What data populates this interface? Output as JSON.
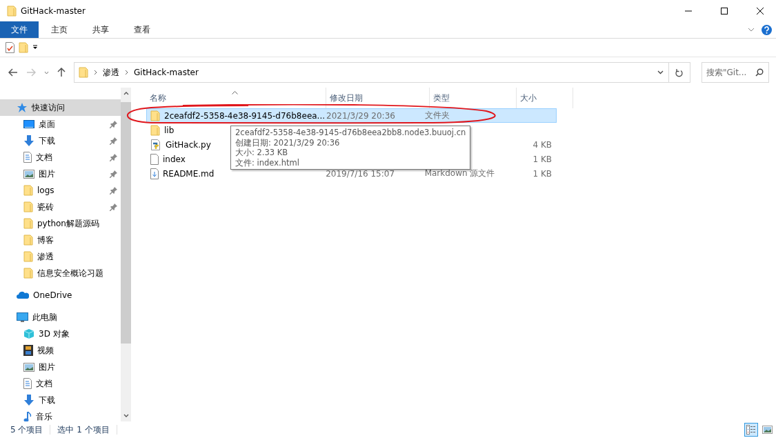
{
  "window": {
    "title": "GitHack-master"
  },
  "ribbon": {
    "tabs": [
      {
        "label": "文件",
        "selected": true
      },
      {
        "label": "主页",
        "selected": false
      },
      {
        "label": "共享",
        "selected": false
      },
      {
        "label": "查看",
        "selected": false
      }
    ]
  },
  "address": {
    "path": [
      "渗透",
      "GitHack-master"
    ],
    "search_placeholder": "搜索\"Git..."
  },
  "sidebar": {
    "items": [
      {
        "label": "快速访问",
        "kind": "star",
        "selected": true,
        "children": [
          {
            "label": "桌面",
            "kind": "desktop",
            "pinned": true,
            "selected": false
          },
          {
            "label": "下载",
            "kind": "download",
            "pinned": true,
            "selected": false
          },
          {
            "label": "文档",
            "kind": "document",
            "pinned": true,
            "selected": false
          },
          {
            "label": "图片",
            "kind": "pictures",
            "pinned": true,
            "selected": false
          },
          {
            "label": "logs",
            "kind": "folder",
            "pinned": true,
            "selected": false
          },
          {
            "label": "瓷砖",
            "kind": "folder",
            "pinned": true,
            "selected": false
          },
          {
            "label": "python解题源码",
            "kind": "folder",
            "pinned": false,
            "selected": false
          },
          {
            "label": "博客",
            "kind": "folder",
            "pinned": false,
            "selected": false
          },
          {
            "label": "渗透",
            "kind": "folder",
            "pinned": false,
            "selected": false
          },
          {
            "label": "信息安全概论习题",
            "kind": "folder",
            "pinned": false,
            "selected": false
          }
        ]
      },
      {
        "label": "OneDrive",
        "kind": "cloud",
        "selected": false
      },
      {
        "label": "此电脑",
        "kind": "pc",
        "selected": false,
        "children": [
          {
            "label": "3D 对象",
            "kind": "cube",
            "selected": false
          },
          {
            "label": "视频",
            "kind": "video",
            "selected": false
          },
          {
            "label": "图片",
            "kind": "pictures",
            "selected": false
          },
          {
            "label": "文档",
            "kind": "document",
            "selected": false
          },
          {
            "label": "下载",
            "kind": "download",
            "selected": false
          },
          {
            "label": "音乐",
            "kind": "music",
            "selected": false
          }
        ]
      }
    ]
  },
  "table": {
    "columns": [
      {
        "label": "名称",
        "sorted": true
      },
      {
        "label": "修改日期",
        "sorted": false
      },
      {
        "label": "类型",
        "sorted": false
      },
      {
        "label": "大小",
        "sorted": false
      }
    ],
    "rows": [
      {
        "kind": "folder",
        "name": "2ceafdf2-5358-4e38-9145-d76b8eea...",
        "date": "2021/3/29 20:36",
        "type": "文件夹",
        "selected": true
      },
      {
        "kind": "folder",
        "name": "lib",
        "selected": false
      },
      {
        "kind": "python",
        "name": "GitHack.py",
        "size": "4 KB",
        "selected": false
      },
      {
        "kind": "file",
        "name": "index",
        "size": "1 KB",
        "selected": false
      },
      {
        "kind": "markdown",
        "name": "README.md",
        "date": "2019/7/16 15:07",
        "type": "Markdown 源文件",
        "size": "1 KB",
        "selected": false
      }
    ]
  },
  "tooltip": {
    "lines": [
      "2ceafdf2-5358-4e38-9145-d76b8eea2bb8.node3.buuoj.cn",
      "创建日期: 2021/3/29 20:36",
      "大小: 2.33 KB",
      "文件: index.html"
    ]
  },
  "status_bar": {
    "item_count": "5 个项目",
    "selection": "选中 1 个项目",
    "views": [
      {
        "kind": "details",
        "selected": true
      },
      {
        "kind": "thumbnails",
        "selected": false
      }
    ]
  }
}
